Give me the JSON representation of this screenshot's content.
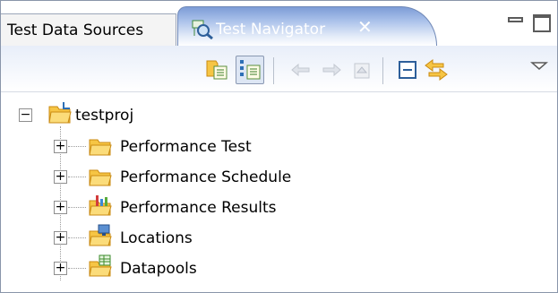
{
  "tabs": {
    "inactive_label": "Test Data Sources",
    "active_label": "Test Navigator"
  },
  "toolbar": {
    "buttons": [
      {
        "name": "show-logical-view-icon",
        "pressed": false
      },
      {
        "name": "show-resource-view-icon",
        "pressed": true
      },
      {
        "name": "back-arrow-icon",
        "enabled": false
      },
      {
        "name": "forward-arrow-icon",
        "enabled": false
      },
      {
        "name": "home-icon",
        "enabled": false
      },
      {
        "name": "collapse-all-icon",
        "enabled": true
      },
      {
        "name": "link-with-editor-icon",
        "enabled": true
      },
      {
        "name": "view-menu-icon",
        "enabled": true
      }
    ]
  },
  "tree": {
    "root": {
      "label": "testproj",
      "expanded": true
    },
    "children": [
      {
        "label": "Performance Test",
        "icon": "folder-icon"
      },
      {
        "label": "Performance Schedule",
        "icon": "folder-icon"
      },
      {
        "label": "Performance Results",
        "icon": "results-folder-icon"
      },
      {
        "label": "Locations",
        "icon": "locations-folder-icon"
      },
      {
        "label": "Datapools",
        "icon": "datapool-folder-icon"
      }
    ]
  },
  "colors": {
    "active_tab_top": "#7d9cd6",
    "folder_fill": "#f6c544",
    "folder_stroke": "#c98a12",
    "border": "#8a96aa"
  }
}
